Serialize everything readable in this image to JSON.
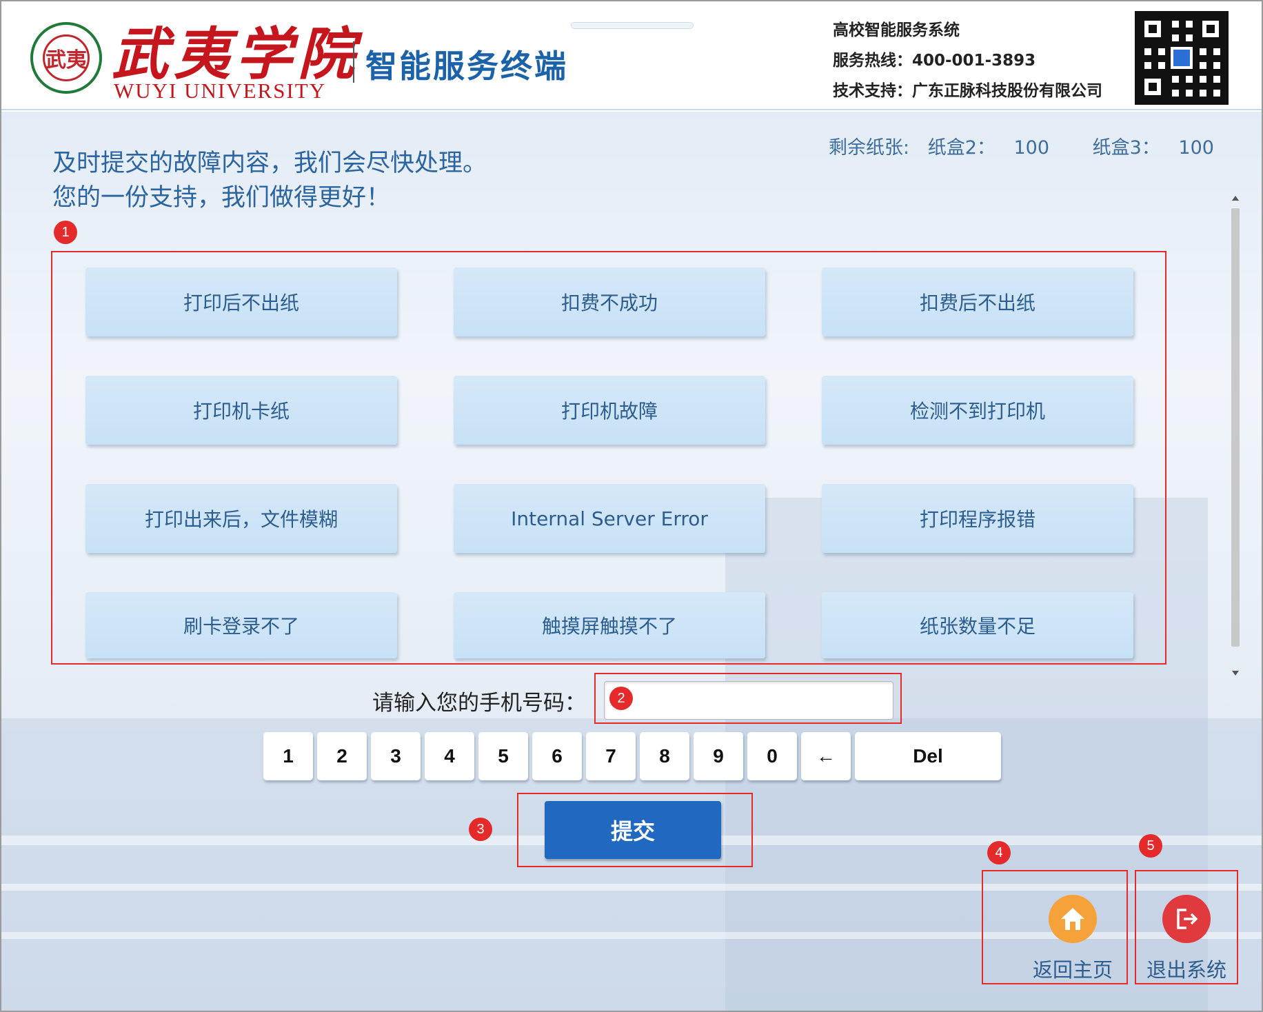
{
  "header": {
    "logo_cn": "武夷学院",
    "logo_en": "WUYI UNIVERSITY",
    "seal_text": "武夷",
    "terminal_title": "智能服务终端",
    "system_name": "高校智能服务系统",
    "hotline": "服务热线：400-001-3893",
    "support": "技术支持：广东正脉科技股份有限公司"
  },
  "paper_status": {
    "label": "剩余纸张:",
    "tray2_label": "纸盒2：",
    "tray2_value": "100",
    "tray3_label": "纸盒3：",
    "tray3_value": "100"
  },
  "intro": {
    "line1": "及时提交的故障内容，我们会尽快处理。",
    "line2": "您的一份支持，我们做得更好！"
  },
  "faults": [
    "打印后不出纸",
    "扣费不成功",
    "扣费后不出纸",
    "打印机卡纸",
    "打印机故障",
    "检测不到打印机",
    "打印出来后，文件模糊",
    "Internal Server Error",
    "打印程序报错",
    "刷卡登录不了",
    "触摸屏触摸不了",
    "纸张数量不足"
  ],
  "phone": {
    "label": "请输入您的手机号码：",
    "value": ""
  },
  "keypad": [
    "1",
    "2",
    "3",
    "4",
    "5",
    "6",
    "7",
    "8",
    "9",
    "0",
    "←",
    "Del"
  ],
  "submit_label": "提交",
  "actions": {
    "home_label": "返回主页",
    "exit_label": "退出系统"
  },
  "markers": [
    "1",
    "2",
    "3",
    "4",
    "5"
  ],
  "colors": {
    "primary": "#2169c0",
    "marker": "#e42a2a",
    "home": "#f5a23a",
    "exit": "#e0393e"
  }
}
